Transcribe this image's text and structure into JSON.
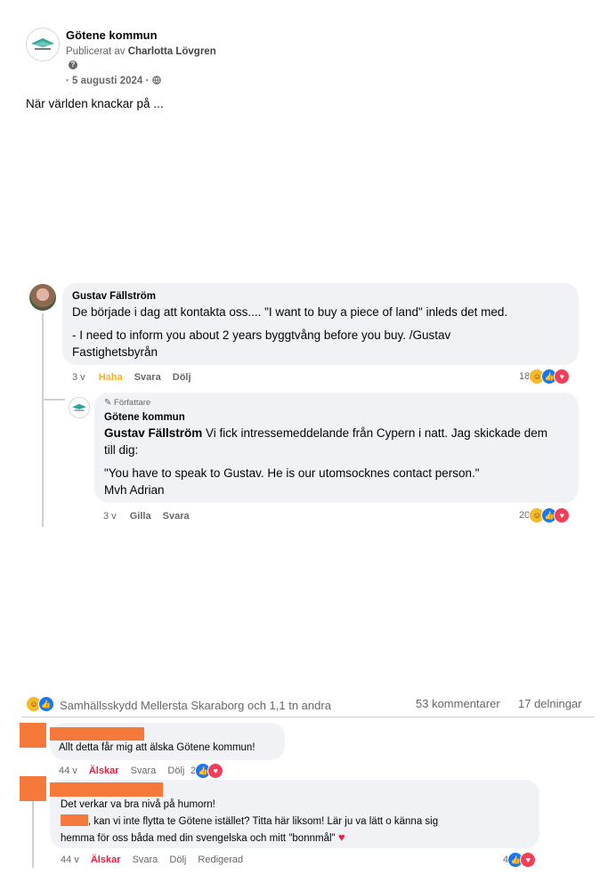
{
  "post": {
    "page_name": "Götene kommun",
    "published_by_prefix": "Publicerat av",
    "published_by_name": "Charlotta Lövgren",
    "date": "· 5 augusti 2024 ·",
    "text": "När världen knackar på ..."
  },
  "comment1": {
    "author": "Gustav Fällström",
    "line1": "De började i dag att kontakta oss.... \"I want to buy a piece of land\" inleds det med.",
    "line2": "- I need to inform you about 2 years byggtvång before you buy. /Gustav",
    "line3": "Fastighetsbyrån",
    "time": "3 v",
    "haha": "Haha",
    "reply": "Svara",
    "hide": "Dölj",
    "reaction_count": "18"
  },
  "reply1": {
    "badge": "Författare",
    "author": "Götene kommun",
    "mention": "Gustav Fällström",
    "line1": " Vi fick intressemeddelande från Cypern i natt. Jag skickade dem",
    "line2": "till dig:",
    "line3": "\"You have to speak to Gustav. He is our utomsocknes contact person.\"",
    "line4": "Mvh Adrian",
    "time": "3 v",
    "like": "Gilla",
    "reply": "Svara",
    "reaction_count": "20"
  },
  "stats": {
    "reactors": "Samhällsskydd Mellersta Skaraborg och 1,1 tn andra",
    "comments": "53 kommentarer",
    "shares": "17 delningar"
  },
  "comment2": {
    "text": "Allt detta får mig att älska Götene kommun!",
    "time": "44 v",
    "love": "Älskar",
    "reply": "Svara",
    "hide": "Dölj",
    "reaction_count": "2"
  },
  "comment3": {
    "line1": "Det verkar va bra nivå på humorn!",
    "line2": ", kan vi inte flytta te Götene istället? Titta här liksom! Lär ju va lätt o känna sig",
    "line3": "hemma för oss båda med din svengelska och mitt \"bonnmål\"",
    "time": "44 v",
    "love": "Älskar",
    "reply": "Svara",
    "hide": "Dölj",
    "edited": "Redigerad",
    "reaction_count": "4"
  },
  "colors": {
    "haha": "#f7b125",
    "love_red": "#e41e3f",
    "like_blue": "#1877f2",
    "bubble": "#f0f2f5",
    "redaction": "#f4793b"
  }
}
